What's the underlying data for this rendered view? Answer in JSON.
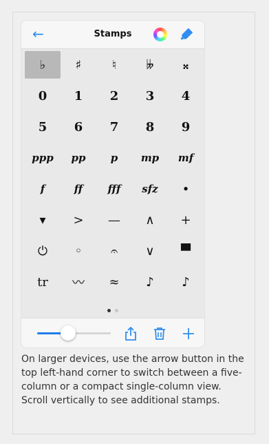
{
  "nav": {
    "title": "Stamps",
    "back_icon": "arrow-left-icon",
    "color_icon": "color-wheel-icon",
    "brush_icon": "paint-brush-icon",
    "accent": "#2f8ef0"
  },
  "stamps": [
    [
      "♭",
      "♯",
      "♮",
      "𝄫",
      "𝄪"
    ],
    [
      "0",
      "1",
      "2",
      "3",
      "4"
    ],
    [
      "5",
      "6",
      "7",
      "8",
      "9"
    ],
    [
      "ppp",
      "pp",
      "p",
      "mp",
      "mf"
    ],
    [
      "f",
      "ff",
      "fff",
      "sfz",
      "•"
    ],
    [
      "▾",
      ">",
      "—",
      "∧",
      "+"
    ],
    [
      "⏻",
      "◦",
      "𝄐",
      "∨",
      "▀"
    ],
    [
      "tr",
      "〰",
      "≈",
      "♪",
      "♪"
    ]
  ],
  "pager": {
    "pages": 2,
    "current": 1
  },
  "toolbar": {
    "slider_value": 0.42,
    "share_icon": "share-icon",
    "trash_icon": "trash-icon",
    "add_icon": "plus-icon"
  },
  "caption": "On larger devices, use the arrow button in the top left-hand corner to switch between a five-column or a compact single-column view. Scroll vertically to see additional stamps."
}
